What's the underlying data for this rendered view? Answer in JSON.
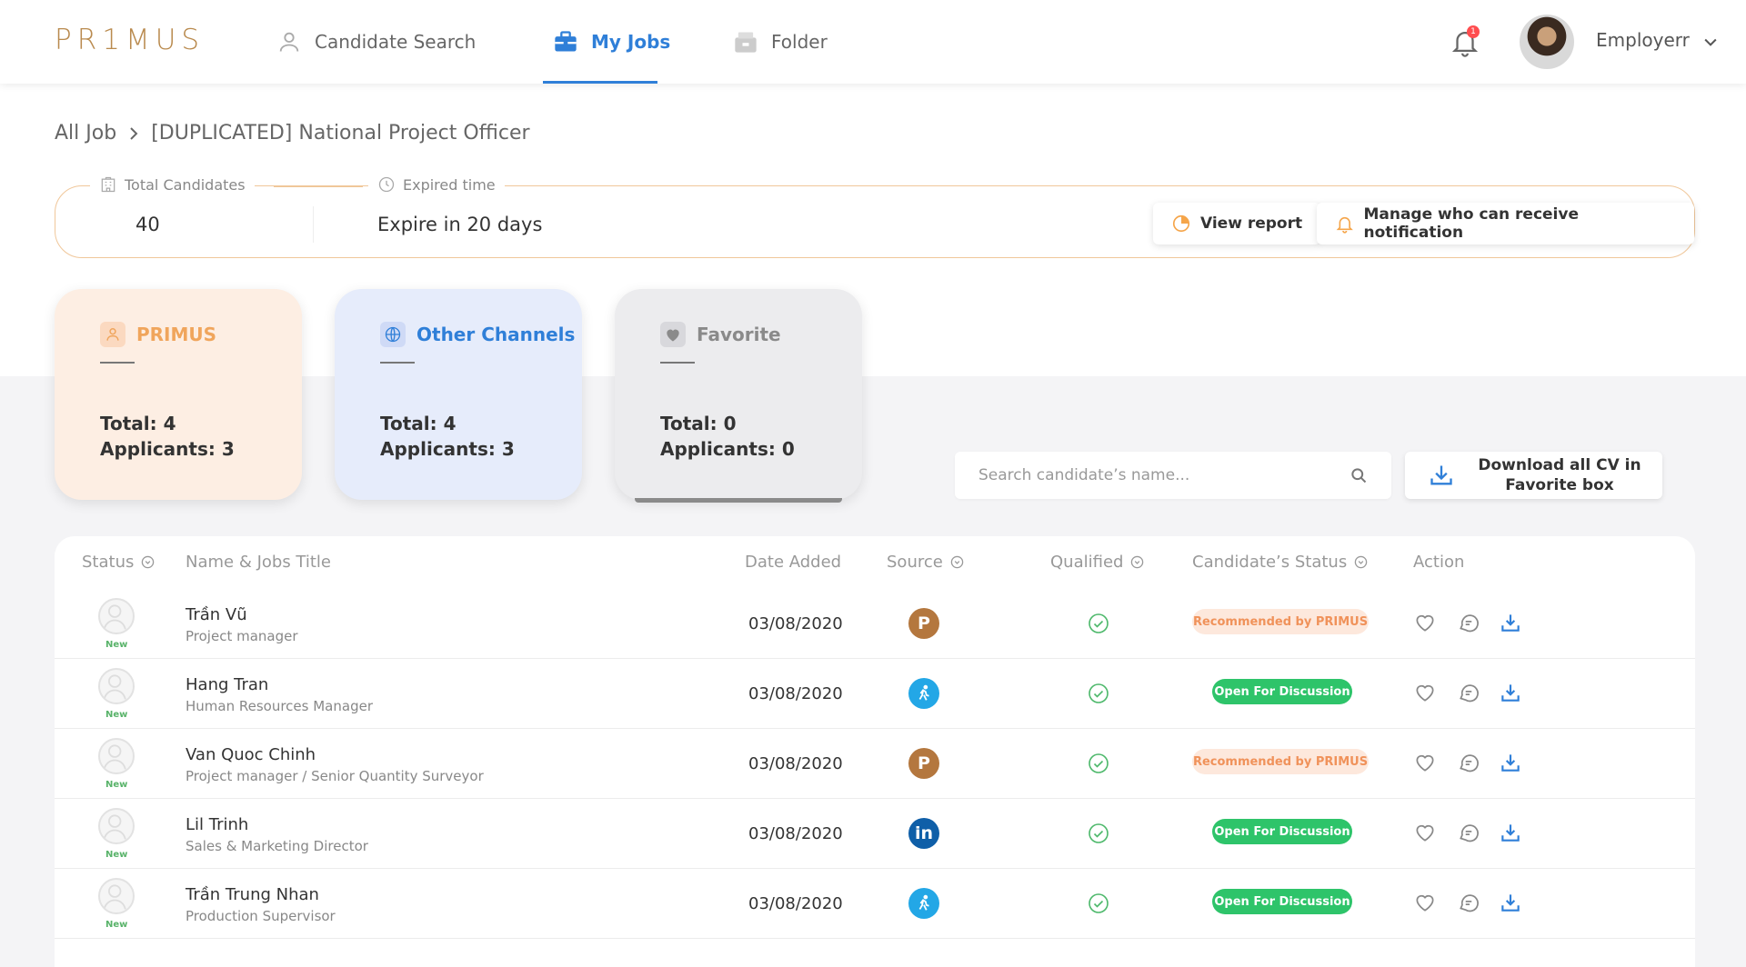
{
  "header": {
    "logo": "PR1MUS",
    "nav": [
      {
        "label": "Candidate Search",
        "icon": "user-icon"
      },
      {
        "label": "My Jobs",
        "icon": "briefcase-icon",
        "active": true
      },
      {
        "label": "Folder",
        "icon": "folder-icon"
      }
    ],
    "notification_count": "1",
    "user_name": "Employerr"
  },
  "breadcrumb": {
    "root": "All Job",
    "current": "[DUPLICATED] National Project Officer"
  },
  "info": {
    "total_label": "Total Candidates",
    "total_value": "40",
    "expired_label": "Expired time",
    "expired_value": "Expire in 20 days",
    "view_report": "View report",
    "manage_notify": "Manage who can receive notification"
  },
  "cards": [
    {
      "name": "PRIMUS",
      "total": "Total: 4",
      "applicants": "Applicants: 3",
      "color": "#f0a55c"
    },
    {
      "name": "Other Channels",
      "total": "Total: 4",
      "applicants": "Applicants: 3",
      "color": "#2f7fd8"
    },
    {
      "name": "Favorite",
      "total": "Total: 0",
      "applicants": "Applicants: 0",
      "color": "#8a8a8a"
    }
  ],
  "search": {
    "placeholder": "Search candidate’s name..."
  },
  "download_all": "Download all CV in Favorite box",
  "table": {
    "columns": [
      "Status",
      "Name & Jobs Title",
      "Date Added",
      "Source",
      "Qualified",
      "Candidate’s Status",
      "Action"
    ],
    "rows": [
      {
        "status": "New",
        "name": "Trần Vũ",
        "title": "Project manager",
        "date": "03/08/2020",
        "source": "P",
        "source_icon": "primus-icon",
        "candidate_status": "Recommended by PRIMUS"
      },
      {
        "status": "New",
        "name": "Hang Tran",
        "title": "Human Resources Manager",
        "date": "03/08/2020",
        "source": "",
        "source_icon": "runner-icon",
        "candidate_status": "Open For Discussion"
      },
      {
        "status": "New",
        "name": "Van Quoc Chinh",
        "title": "Project manager / Senior Quantity Surveyor",
        "date": "03/08/2020",
        "source": "P",
        "source_icon": "primus-icon",
        "candidate_status": "Recommended by PRIMUS"
      },
      {
        "status": "New",
        "name": "Lil Trinh",
        "title": "Sales & Marketing Director",
        "date": "03/08/2020",
        "source": "in",
        "source_icon": "linkedin-icon",
        "candidate_status": "Open For Discussion"
      },
      {
        "status": "New",
        "name": "Trần Trung Nhan",
        "title": "Production Supervisor",
        "date": "03/08/2020",
        "source": "",
        "source_icon": "runner-icon",
        "candidate_status": "Open For Discussion"
      }
    ]
  }
}
